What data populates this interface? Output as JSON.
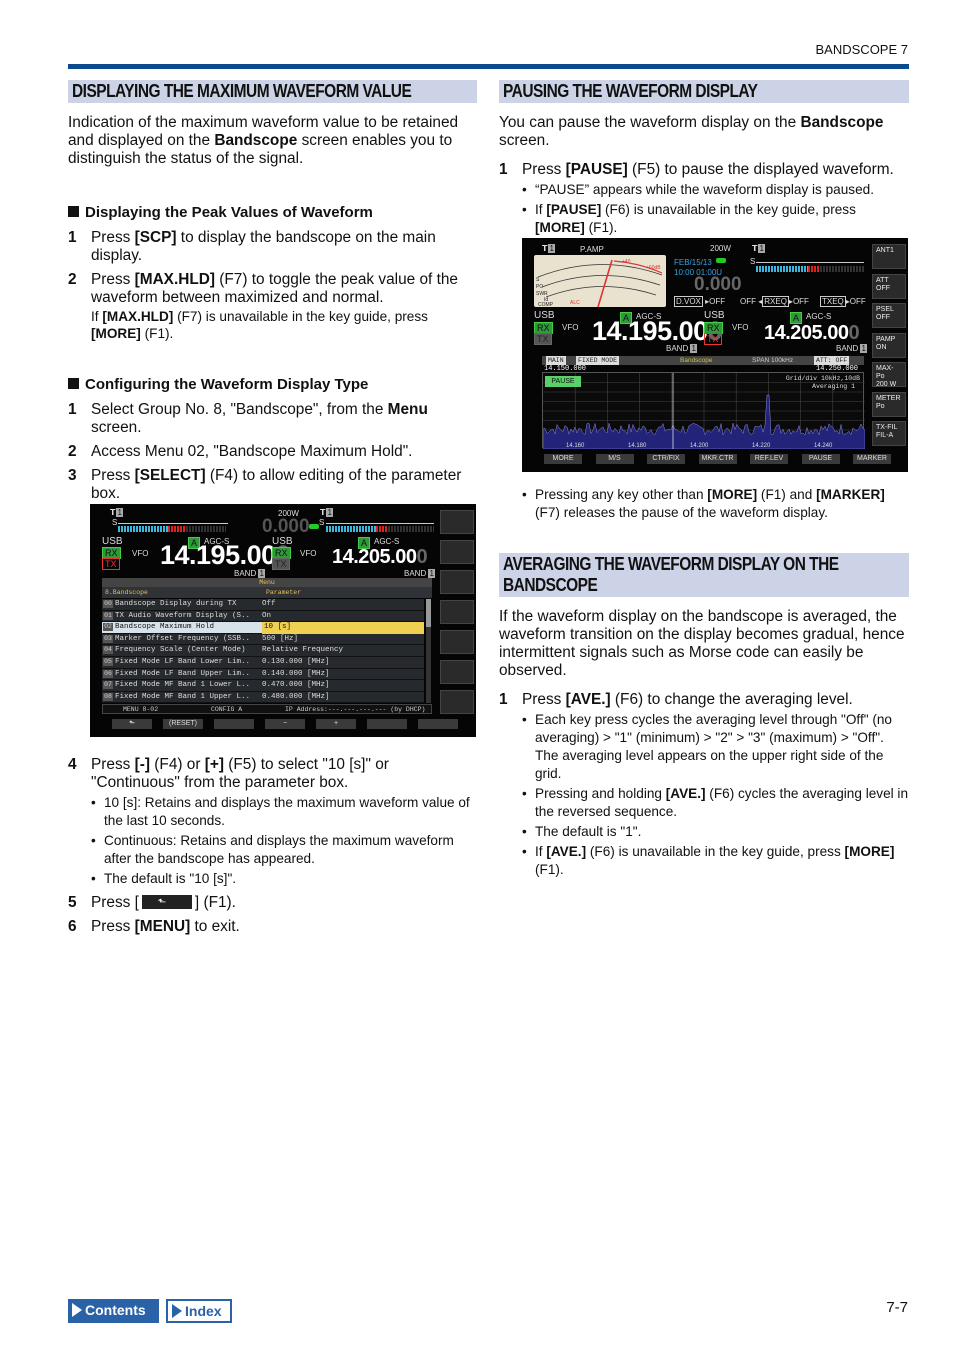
{
  "header": {
    "chapter": "BANDSCOPE 7"
  },
  "left": {
    "title": "DISPLAYING THE MAXIMUM WAVEFORM VALUE",
    "intro": [
      "Indication of the maximum waveform value to be retained and displayed on the ",
      "Bandscope",
      " screen enables you to distinguish the status of the signal."
    ],
    "sub1": {
      "title": "Displaying the Peak Values of Waveform",
      "steps": [
        {
          "num": "1",
          "pre": "Press ",
          "key": "[SCP]",
          "post": " to display the bandscope on the main display."
        },
        {
          "num": "2",
          "pre": "Press ",
          "key": "[MAX.HLD]",
          "post": " (F7) to toggle the peak value of the waveform between maximized and normal."
        }
      ],
      "note": {
        "pre": "If ",
        "key1": "[MAX.HLD]",
        "mid": " (F7) is unavailable in the key guide, press ",
        "key2": "[MORE]",
        "post": " (F1)."
      }
    },
    "sub2": {
      "title": "Configuring the Waveform Display Type",
      "steps": [
        {
          "num": "1",
          "pre": "Select Group No. 8, \"Bandscope\", from the ",
          "key": "Menu",
          "post": " screen."
        },
        {
          "num": "2",
          "text": "Access Menu 02, \"Bandscope Maximum Hold\"."
        },
        {
          "num": "3",
          "pre": "Press ",
          "key": "[SELECT]",
          "post": " (F4) to allow editing of the parameter box."
        }
      ],
      "step4": {
        "num": "4",
        "pre": "Press ",
        "k1": "[-]",
        "mid1": " (F4) or ",
        "k2": "[+]",
        "post": " (F5) to select \"10 [s]\" or \"Continuous\" from the parameter box."
      },
      "bullets": [
        "10 [s]: Retains and displays the maximum waveform value of the last 10 seconds.",
        "Continuous: Retains and displays the maximum waveform after the bandscope has appeared.",
        "The default is \"10 [s]\"."
      ],
      "step5": {
        "num": "5",
        "pre": "Press [",
        "post": "] (F1)."
      },
      "step6": {
        "num": "6",
        "pre": "Press ",
        "key": "[MENU]",
        "post": " to exit."
      }
    },
    "screen": {
      "power": "200W",
      "center": "0.000",
      "vfoA": {
        "mode": "USB",
        "agc": "AGC-S",
        "ant": "A",
        "rx": "RX",
        "tx": "TX",
        "vfo": "VFO",
        "freq": "14.195.00",
        "freq_dim": "0",
        "band": "BAND",
        "band_num": "1"
      },
      "vfoB": {
        "mode": "USB",
        "agc": "AGC-S",
        "ant": "A",
        "rx": "RX",
        "tx": "TX",
        "vfo": "VFO",
        "freq": "14.205.00",
        "freq_dim": "0",
        "band": "BAND",
        "band_num": "1"
      },
      "menu_title": "Menu",
      "group": "8.Bandscope",
      "param_header": "Parameter",
      "rows": [
        {
          "n": "00",
          "name": "Bandscope Display during TX",
          "param": "Off"
        },
        {
          "n": "01",
          "name": "TX Audio Waveform Display (S..",
          "param": "On"
        },
        {
          "n": "02",
          "name": "Bandscope Maximum Hold",
          "param": "10  [s]",
          "selected": true
        },
        {
          "n": "03",
          "name": "Marker Offset Frequency (SSB..",
          "param": "500 [Hz]"
        },
        {
          "n": "04",
          "name": "Frequency Scale (Center Mode)",
          "param": "Relative Frequency"
        },
        {
          "n": "05",
          "name": "Fixed Mode LF Band Lower Lim..",
          "param": " 0.130.000 [MHz]"
        },
        {
          "n": "06",
          "name": "Fixed Mode LF Band Upper Lim..",
          "param": " 0.140.000 [MHz]"
        },
        {
          "n": "07",
          "name": "Fixed Mode MF Band 1 Lower L..",
          "param": " 0.470.000 [MHz]"
        },
        {
          "n": "08",
          "name": "Fixed Mode MF Band 1 Upper L..",
          "param": " 0.480.000 [MHz]"
        }
      ],
      "status": [
        "MENU 8-02",
        "CONFIG A",
        "IP Address:---.---.---.--- (by DHCP)"
      ],
      "fkeys": [
        "",
        "(RESET)",
        "",
        "−",
        "+",
        "",
        ""
      ]
    }
  },
  "right": {
    "title": "PAUSING THE WAVEFORM DISPLAY",
    "intro": [
      "You can pause the waveform display on the ",
      "Bandscope",
      " screen."
    ],
    "step1": {
      "num": "1",
      "pre": "Press ",
      "key": "[PAUSE]",
      "post": " (F5) to pause the displayed waveform."
    },
    "bullet1": "“PAUSE” appears while the waveform display is paused.",
    "bullet2": {
      "pre": "If ",
      "k1": "[PAUSE]",
      "mid": " (F6) is unavailable in the key guide, press ",
      "k2": "[MORE]",
      "post": " (F1)."
    },
    "bullet3": {
      "pre": "Pressing any key other than ",
      "k1": "[MORE]",
      "mid": " (F1) and ",
      "k2": "[MARKER]",
      "post": " (F7) releases the pause of the waveform display."
    },
    "screen": {
      "pamp": "P.AMP",
      "power": "200W",
      "date": "FEB/15/13",
      "time": "10:00 01:00U",
      "center": "0.000",
      "dvox": "D.VOX",
      "dvox_val": "OFF",
      "rxeq_pre": "OFF",
      "rxeq": "RXEQ",
      "rxeq_val": "OFF",
      "txeq": "TXEQ",
      "txeq_val": "OFF",
      "vfoA": {
        "mode": "USB",
        "agc": "AGC-S",
        "ant": "A",
        "rx": "RX",
        "tx": "TX",
        "vfo": "VFO",
        "freq": "14.195.00",
        "freq_dim": "0",
        "band": "BAND",
        "band_num": "1"
      },
      "vfoB": {
        "mode": "USB",
        "agc": "AGC-S",
        "ant": "A",
        "rx": "RX",
        "tx": "TX",
        "vfo": "VFO",
        "freq": "14.205.00",
        "freq_dim": "0",
        "band": "BAND",
        "band_num": "1"
      },
      "scope_bar": {
        "main": "MAIN",
        "mode": "FIXED MODE",
        "title": "Bandscope",
        "span": "SPAN 100kHz",
        "att": "ATT: OFF"
      },
      "range_lo": "14.150.000",
      "range_hi": "14.250.000",
      "pause": "PAUSE",
      "grid": "Grid/div 10kHz,10dB",
      "avg": "Averaging 1",
      "xticks": [
        "14.160",
        "14.180",
        "14.200",
        "14.220",
        "14.240"
      ],
      "side": [
        "ANT1",
        "ATT\nOFF",
        "PSEL\nOFF",
        "PAMP\nON",
        "MAX-Po\n200 W",
        "METER\nPo",
        "TX-FIL\nFIL-A"
      ],
      "fkeys": [
        "MORE",
        "M/S",
        "CTR/FIX",
        "MKR.CTR",
        "REF.LEV",
        "PAUSE",
        "MARKER"
      ]
    }
  },
  "right2": {
    "title_line1": "AVERAGING THE WAVEFORM DISPLAY ON THE",
    "title_line2": "BANDSCOPE",
    "intro": "If the waveform display on the bandscope is averaged, the waveform transition on the display becomes gradual, hence intermittent signals such as Morse code can easily be observed.",
    "step1": {
      "num": "1",
      "pre": "Press ",
      "key": "[AVE.]",
      "post": " (F6) to change the averaging level."
    },
    "bullet1": "Each key press cycles the averaging level through \"Off\" (no averaging) > \"1\" (minimum) > \"2\" > \"3\" (maximum) > \"Off\". The averaging level appears on the upper right side of the grid.",
    "bullet2": {
      "pre": "Pressing and holding ",
      "key": "[AVE.]",
      "post": " (F6) cycles the averaging level in the reversed sequence."
    },
    "bullet3": "The default is \"1\".",
    "bullet4": {
      "pre": "If ",
      "k1": "[AVE.]",
      "mid": " (F6) is unavailable in the key guide, press ",
      "k2": "[MORE]",
      "post": " (F1)."
    }
  },
  "footer": {
    "contents": "Contents",
    "index": "Index",
    "page": "7-7"
  },
  "colors": {
    "rule": "#0b4a8c",
    "section_bg": "#ccd3e6",
    "contents_bg": "#2a62a8",
    "index_border": "#2a62a8"
  }
}
